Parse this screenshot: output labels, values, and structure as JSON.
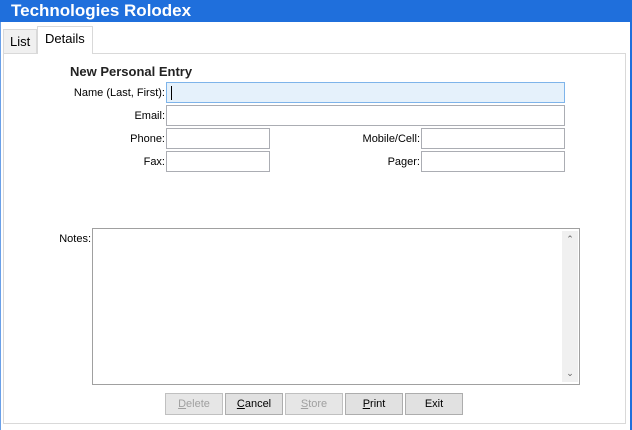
{
  "window": {
    "title": "Technologies Rolodex"
  },
  "tabs": [
    {
      "label": "List",
      "active": false
    },
    {
      "label": "Details",
      "active": true
    }
  ],
  "form": {
    "heading": "New Personal Entry",
    "name": {
      "label": "Name (Last, First):",
      "value": ""
    },
    "email": {
      "label": "Email:",
      "value": ""
    },
    "phone": {
      "label": "Phone:",
      "value": ""
    },
    "mobile": {
      "label": "Mobile/Cell:",
      "value": ""
    },
    "fax": {
      "label": "Fax:",
      "value": ""
    },
    "pager": {
      "label": "Pager:",
      "value": ""
    },
    "notes": {
      "label": "Notes:",
      "value": ""
    }
  },
  "buttons": [
    {
      "label": "Delete",
      "mnemonic": "D",
      "enabled": false
    },
    {
      "label": "Cancel",
      "mnemonic": "C",
      "enabled": true
    },
    {
      "label": "Store",
      "mnemonic": "S",
      "enabled": false
    },
    {
      "label": "Print",
      "mnemonic": "P",
      "enabled": true
    },
    {
      "label": "Exit",
      "mnemonic": "x",
      "enabled": true
    }
  ],
  "colors": {
    "titlebar": "#1f6fdc",
    "focused_field": "#e5f1fb"
  }
}
